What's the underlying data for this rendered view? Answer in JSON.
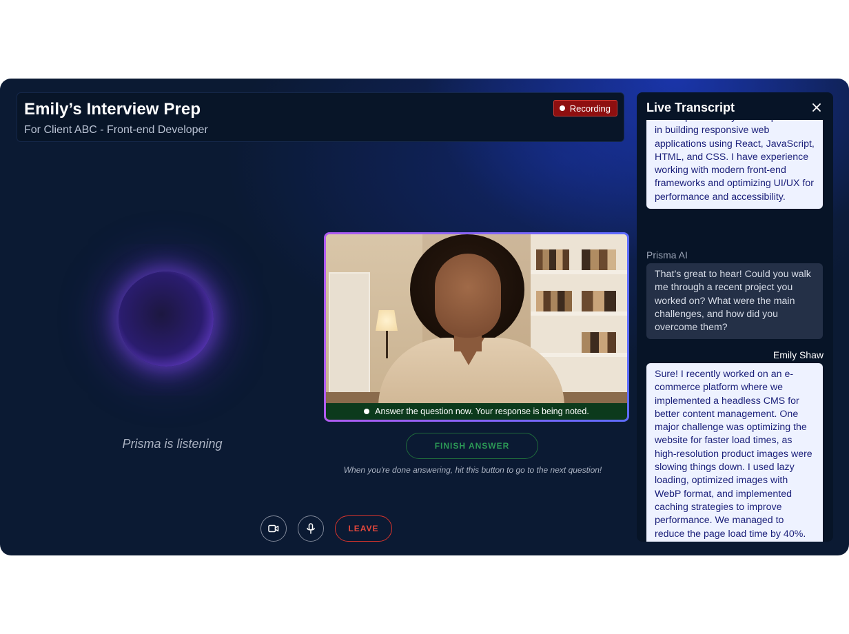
{
  "header": {
    "title": "Emily’s Interview Prep",
    "subtitle": "For Client ABC - Front-end Developer",
    "recording_label": "Recording"
  },
  "assistant": {
    "status": "Prisma is listening"
  },
  "video": {
    "caption": "Answer the question now. Your response is being noted."
  },
  "finish": {
    "button_label": "FINISH ANSWER",
    "hint": "When you're done answering, hit this button to go to the next question!"
  },
  "controls": {
    "camera_icon": "video-camera-icon",
    "mic_icon": "microphone-icon",
    "leave_label": "LEAVE"
  },
  "transcript": {
    "title": "Live Transcript",
    "messages": [
      {
        "speaker": "",
        "role": "user",
        "text": "for the past three years. I specialize in building responsive web applications using React, JavaScript, HTML, and CSS. I have experience working with modern front-end frameworks and optimizing UI/UX for performance and accessibility."
      },
      {
        "speaker": "Prisma AI",
        "role": "ai",
        "text": "That’s great to hear! Could you walk me through a recent project you worked on? What were the main challenges, and how did you overcome them?"
      },
      {
        "speaker": "Emily Shaw",
        "role": "user",
        "text": "Sure! I recently worked on an e-commerce platform where we implemented a headless CMS for better content management. One major challenge was optimizing the website for faster load times, as high-resolution product images were slowing things down. I used lazy loading, optimized images with WebP format, and implemented caching strategies to improve performance. We managed to reduce the page load time by 40%."
      }
    ]
  },
  "colors": {
    "background": "#0b1a33",
    "recording": "#8e0f10",
    "finish_green": "#2c9a56",
    "leave_red": "#e2473c",
    "user_bubble": "#eef2ff",
    "ai_bubble": "#243047"
  }
}
